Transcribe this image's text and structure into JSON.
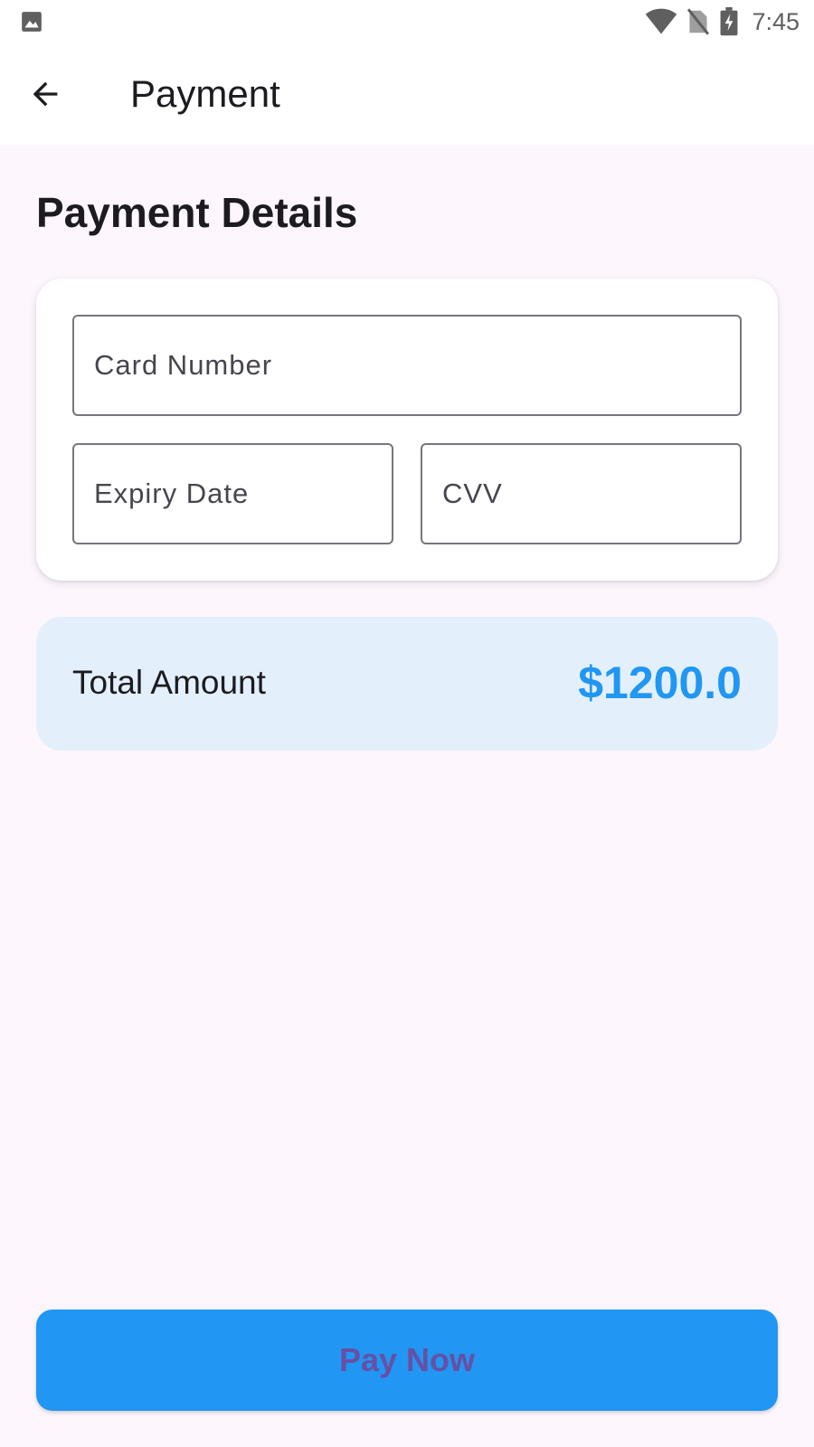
{
  "status_bar": {
    "time": "7:45",
    "icons": [
      "image-notification-icon",
      "wifi-icon",
      "no-sim-icon",
      "battery-charging-icon"
    ]
  },
  "app_bar": {
    "title": "Payment",
    "back_icon": "arrow-back-icon"
  },
  "main": {
    "heading": "Payment Details",
    "form": {
      "card_number": {
        "placeholder": "Card Number",
        "value": ""
      },
      "expiry_date": {
        "placeholder": "Expiry Date",
        "value": ""
      },
      "cvv": {
        "placeholder": "CVV",
        "value": ""
      }
    },
    "total": {
      "label": "Total Amount",
      "amount": "$1200.0"
    },
    "pay_button": {
      "label": "Pay Now"
    }
  },
  "colors": {
    "primary": "#2196f3",
    "button_text": "#6750a4",
    "background": "#fdf6fd",
    "total_background": "#e3f0fc",
    "text": "#1d1b20"
  }
}
